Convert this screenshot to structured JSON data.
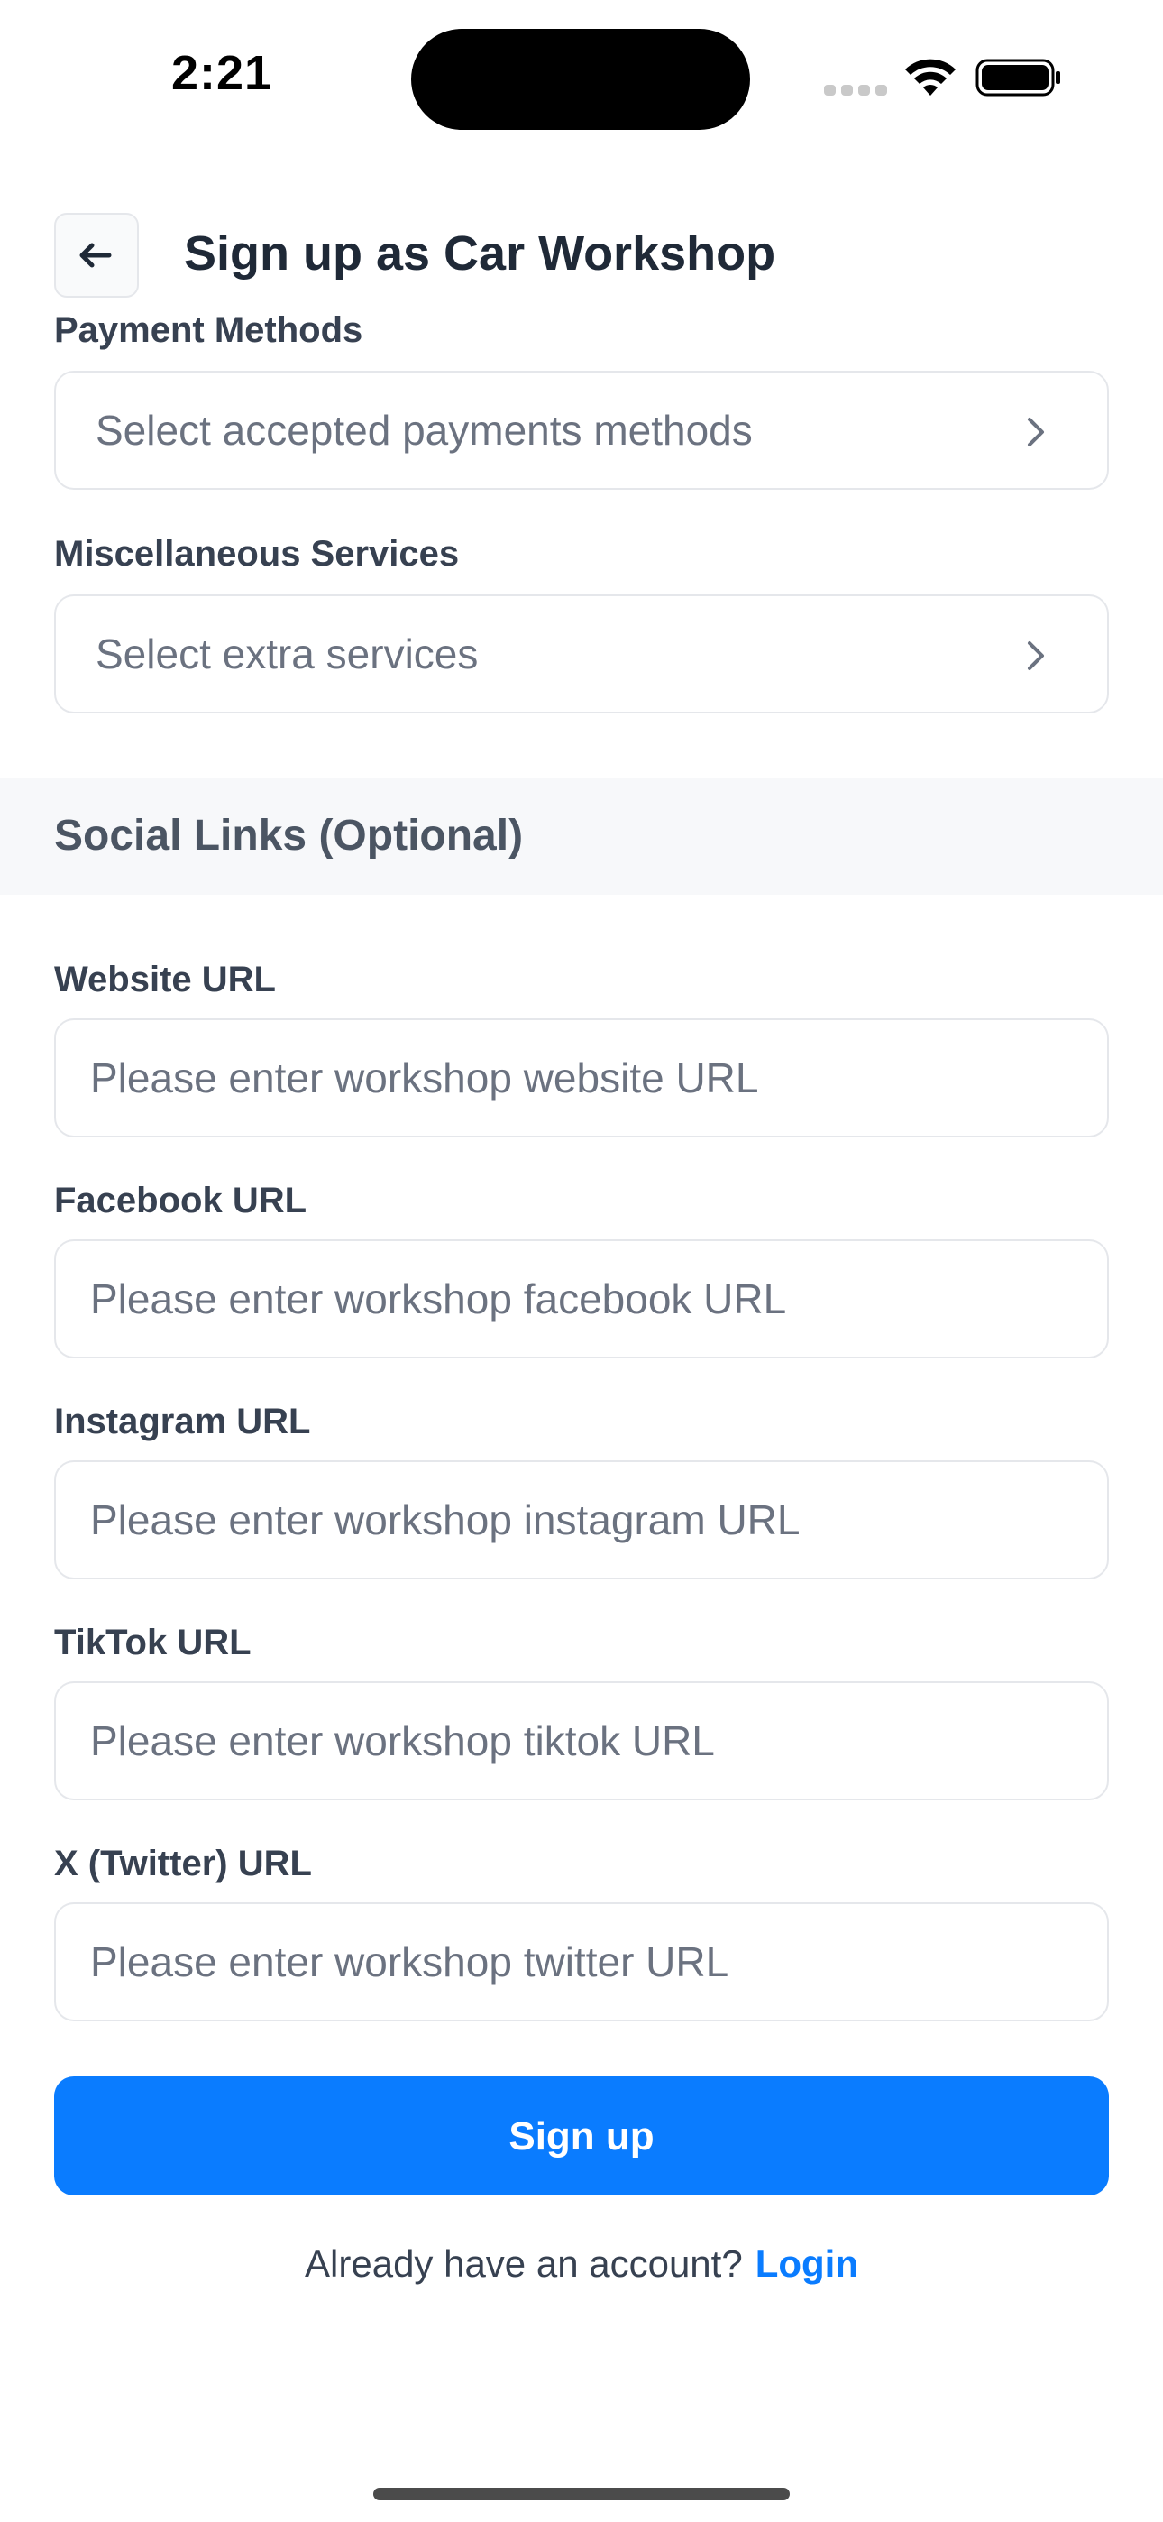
{
  "status_bar": {
    "time": "2:21"
  },
  "header": {
    "back_icon": "arrow-left-icon",
    "title": "Sign up as Car Workshop"
  },
  "payment_methods": {
    "label": "Payment Methods",
    "placeholder": "Select accepted payments methods"
  },
  "misc_services": {
    "label": "Miscellaneous Services",
    "placeholder": "Select extra services"
  },
  "social_section": {
    "title": "Social Links (Optional)"
  },
  "fields": {
    "website": {
      "label": "Website URL",
      "placeholder": "Please enter workshop website URL",
      "value": ""
    },
    "facebook": {
      "label": "Facebook URL",
      "placeholder": "Please enter workshop facebook URL",
      "value": ""
    },
    "instagram": {
      "label": "Instagram URL",
      "placeholder": "Please enter workshop instagram URL",
      "value": ""
    },
    "tiktok": {
      "label": "TikTok URL",
      "placeholder": "Please enter workshop tiktok URL",
      "value": ""
    },
    "twitter": {
      "label": "X (Twitter) URL",
      "placeholder": "Please enter workshop twitter URL",
      "value": ""
    }
  },
  "actions": {
    "signup_label": "Sign up"
  },
  "footer": {
    "prompt": "Already have an account?",
    "login_label": "Login"
  },
  "colors": {
    "primary": "#0a7cff",
    "section_background": "#f7f8fa",
    "border": "#e5e7eb",
    "placeholder": "#6b7280"
  }
}
